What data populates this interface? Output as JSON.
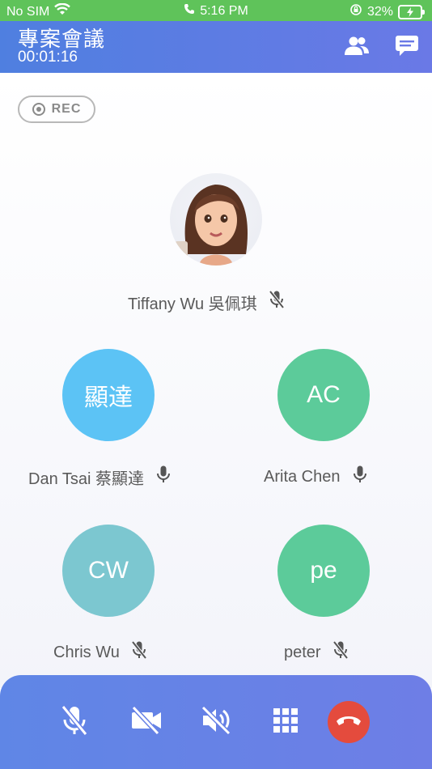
{
  "status_bar": {
    "carrier": "No SIM",
    "time": "5:16 PM",
    "battery": "32%"
  },
  "header": {
    "title": "專案會議",
    "timer": "00:01:16",
    "participants_icon": "participants-icon",
    "chat_icon": "chat-icon"
  },
  "rec": {
    "label": "REC"
  },
  "host": {
    "name": "Tiffany Wu 吳佩琪",
    "mic": "muted"
  },
  "participants": [
    {
      "initials": "顯達",
      "name": "Dan Tsai 蔡顯達",
      "mic": "on",
      "color": "#5cc3f5"
    },
    {
      "initials": "AC",
      "name": "Arita Chen",
      "mic": "on",
      "color": "#5ccb9a"
    },
    {
      "initials": "CW",
      "name": "Chris Wu",
      "mic": "muted",
      "color": "#7cc7d0"
    },
    {
      "initials": "pe",
      "name": "peter",
      "mic": "muted",
      "color": "#5ccb9a"
    }
  ],
  "controls": [
    "mic-off-icon",
    "video-off-icon",
    "speaker-off-icon",
    "keypad-icon",
    "end-call-icon"
  ],
  "colors": {
    "header": "#5b7de3",
    "status": "#5fc35a",
    "end": "#e44b3d",
    "bottom": "#6781e6"
  }
}
